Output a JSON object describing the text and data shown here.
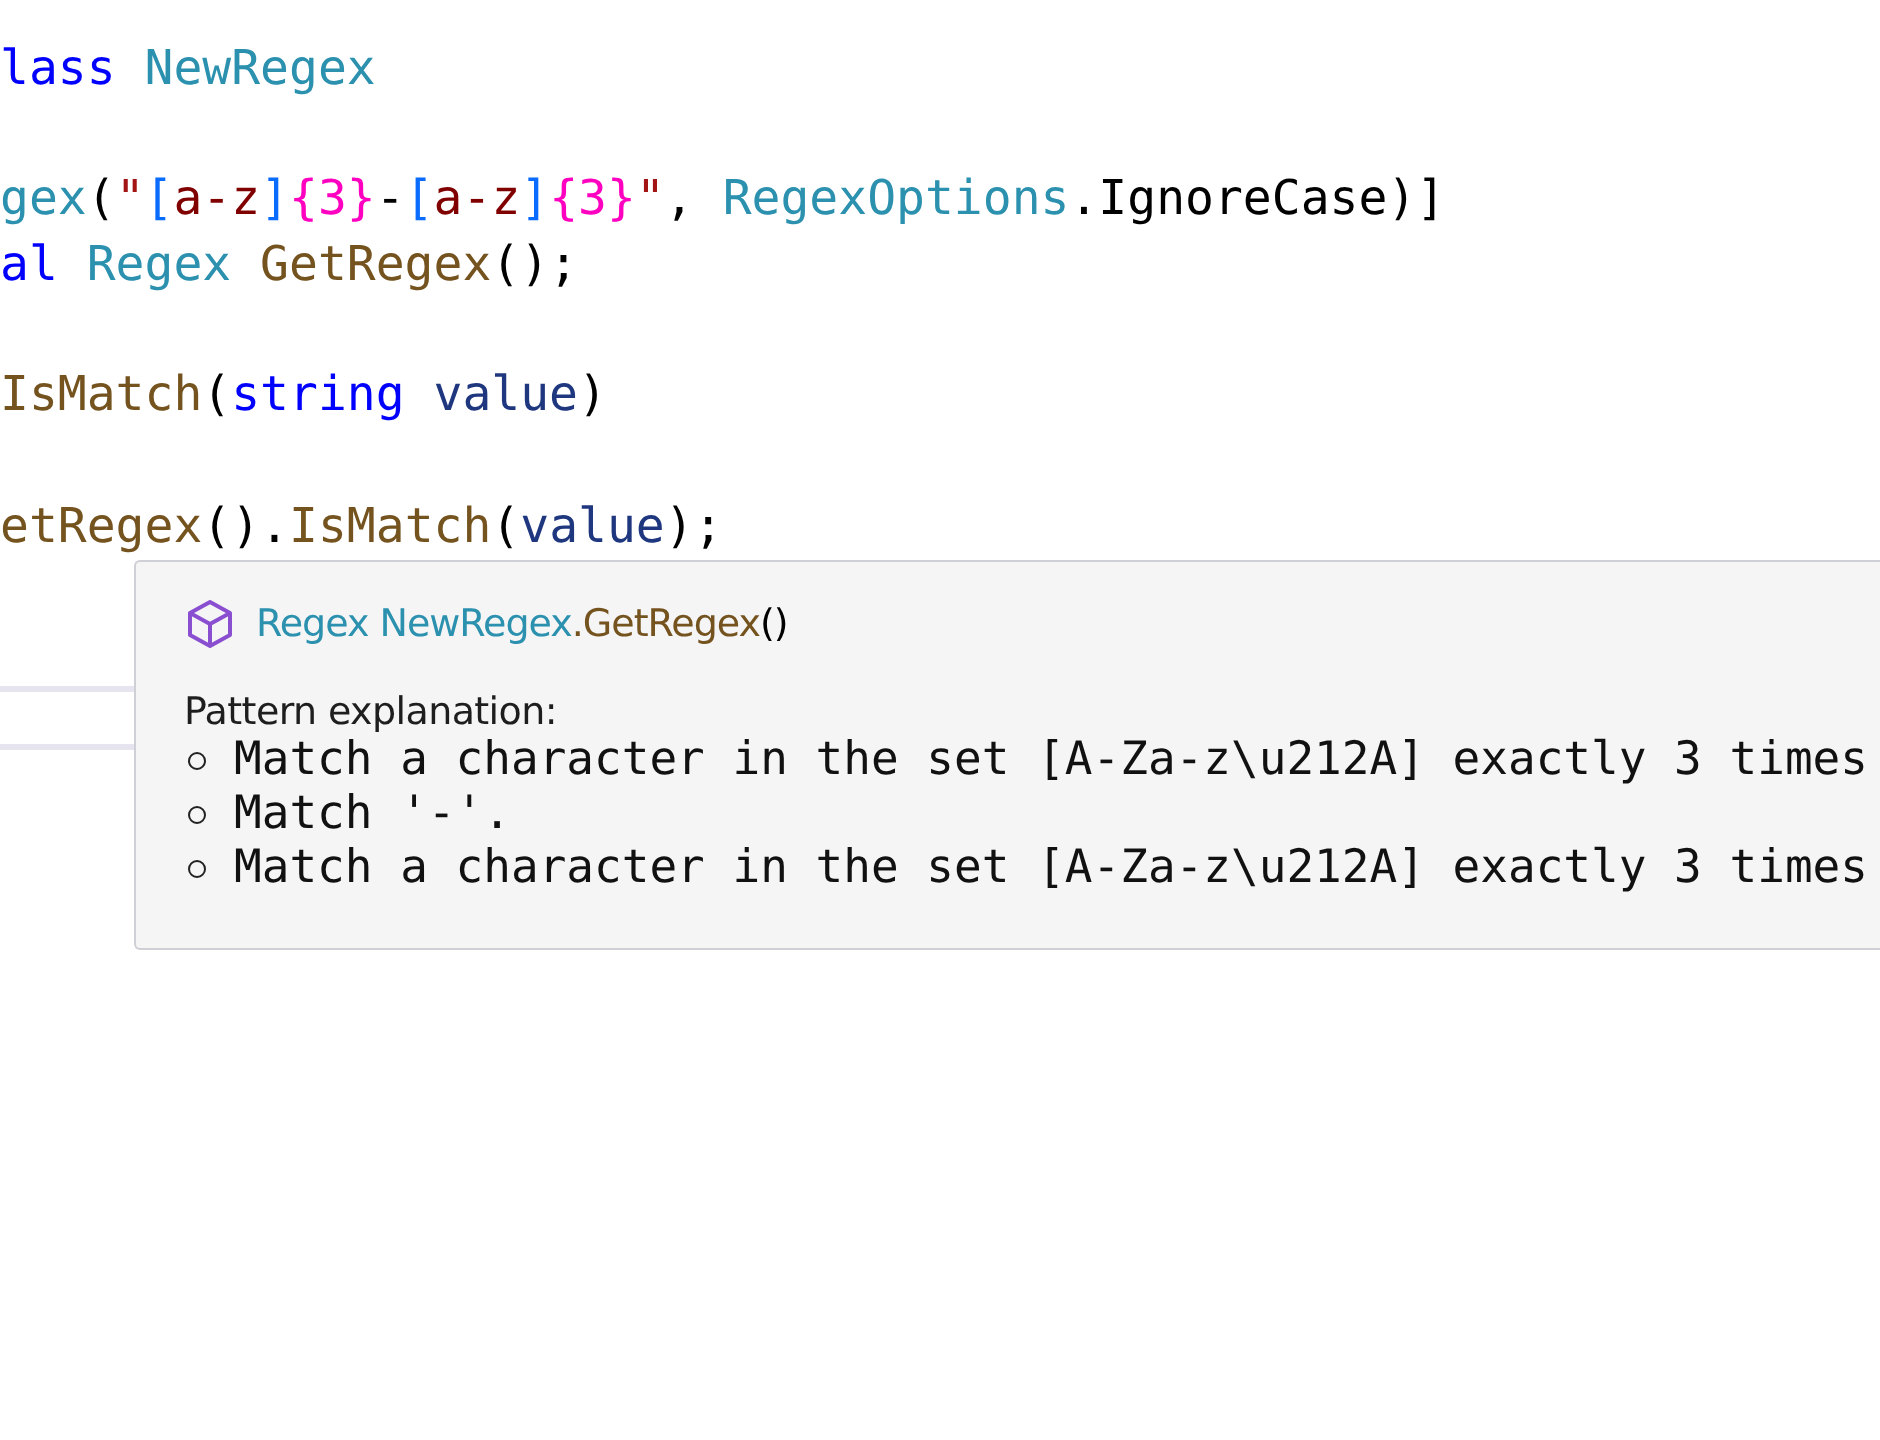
{
  "code_lines": [
    {
      "kind": "code",
      "tokens": [
        {
          "text": "lass",
          "kind": "keyword"
        },
        {
          "text": " NewRegex",
          "kind": "type"
        }
      ]
    },
    {
      "kind": "blank"
    },
    {
      "kind": "code",
      "tokens": [
        {
          "text": "gex",
          "kind": "type"
        },
        {
          "text": "(",
          "kind": "plain"
        },
        {
          "text": "\"",
          "kind": "string"
        },
        {
          "text": "[",
          "kind": "regex-bracket"
        },
        {
          "text": "a-z",
          "kind": "regex-range"
        },
        {
          "text": "]",
          "kind": "regex-bracket"
        },
        {
          "text": "{3}",
          "kind": "regex-quantifier"
        },
        {
          "text": "-",
          "kind": "regex-literal"
        },
        {
          "text": "[",
          "kind": "regex-bracket"
        },
        {
          "text": "a-z",
          "kind": "regex-range"
        },
        {
          "text": "]",
          "kind": "regex-bracket"
        },
        {
          "text": "{3}",
          "kind": "regex-quantifier"
        },
        {
          "text": "\"",
          "kind": "string"
        },
        {
          "text": ", ",
          "kind": "plain"
        },
        {
          "text": "RegexOptions",
          "kind": "type"
        },
        {
          "text": ".IgnoreCase)]",
          "kind": "plain"
        }
      ]
    },
    {
      "kind": "code",
      "tokens": [
        {
          "text": "al",
          "kind": "keyword"
        },
        {
          "text": " Regex",
          "kind": "type"
        },
        {
          "text": " GetRegex",
          "kind": "method"
        },
        {
          "text": "();",
          "kind": "plain"
        }
      ]
    },
    {
      "kind": "blank"
    },
    {
      "kind": "code",
      "tokens": [
        {
          "text": "IsMatch",
          "kind": "method"
        },
        {
          "text": "(",
          "kind": "plain"
        },
        {
          "text": "string",
          "kind": "keyword"
        },
        {
          "text": " value",
          "kind": "parameter"
        },
        {
          "text": ")",
          "kind": "plain"
        }
      ]
    },
    {
      "kind": "blank"
    },
    {
      "kind": "code",
      "tokens": [
        {
          "text": "etRegex",
          "kind": "method"
        },
        {
          "text": "().",
          "kind": "plain"
        },
        {
          "text": "IsMatch",
          "kind": "method"
        },
        {
          "text": "(",
          "kind": "plain"
        },
        {
          "text": "value",
          "kind": "parameter"
        },
        {
          "text": ");",
          "kind": "plain"
        }
      ]
    }
  ],
  "tooltip": {
    "signature": [
      {
        "text": "Regex NewRegex",
        "kind": "type"
      },
      {
        "text": ".GetRegex",
        "kind": "method"
      },
      {
        "text": "()",
        "kind": "plain"
      }
    ],
    "heading": "Pattern explanation:",
    "items": [
      "Match a character in the set [A-Za-z\\u212A] exactly 3 times",
      "Match '-'.",
      "Match a character in the set [A-Za-z\\u212A] exactly 3 times"
    ]
  }
}
